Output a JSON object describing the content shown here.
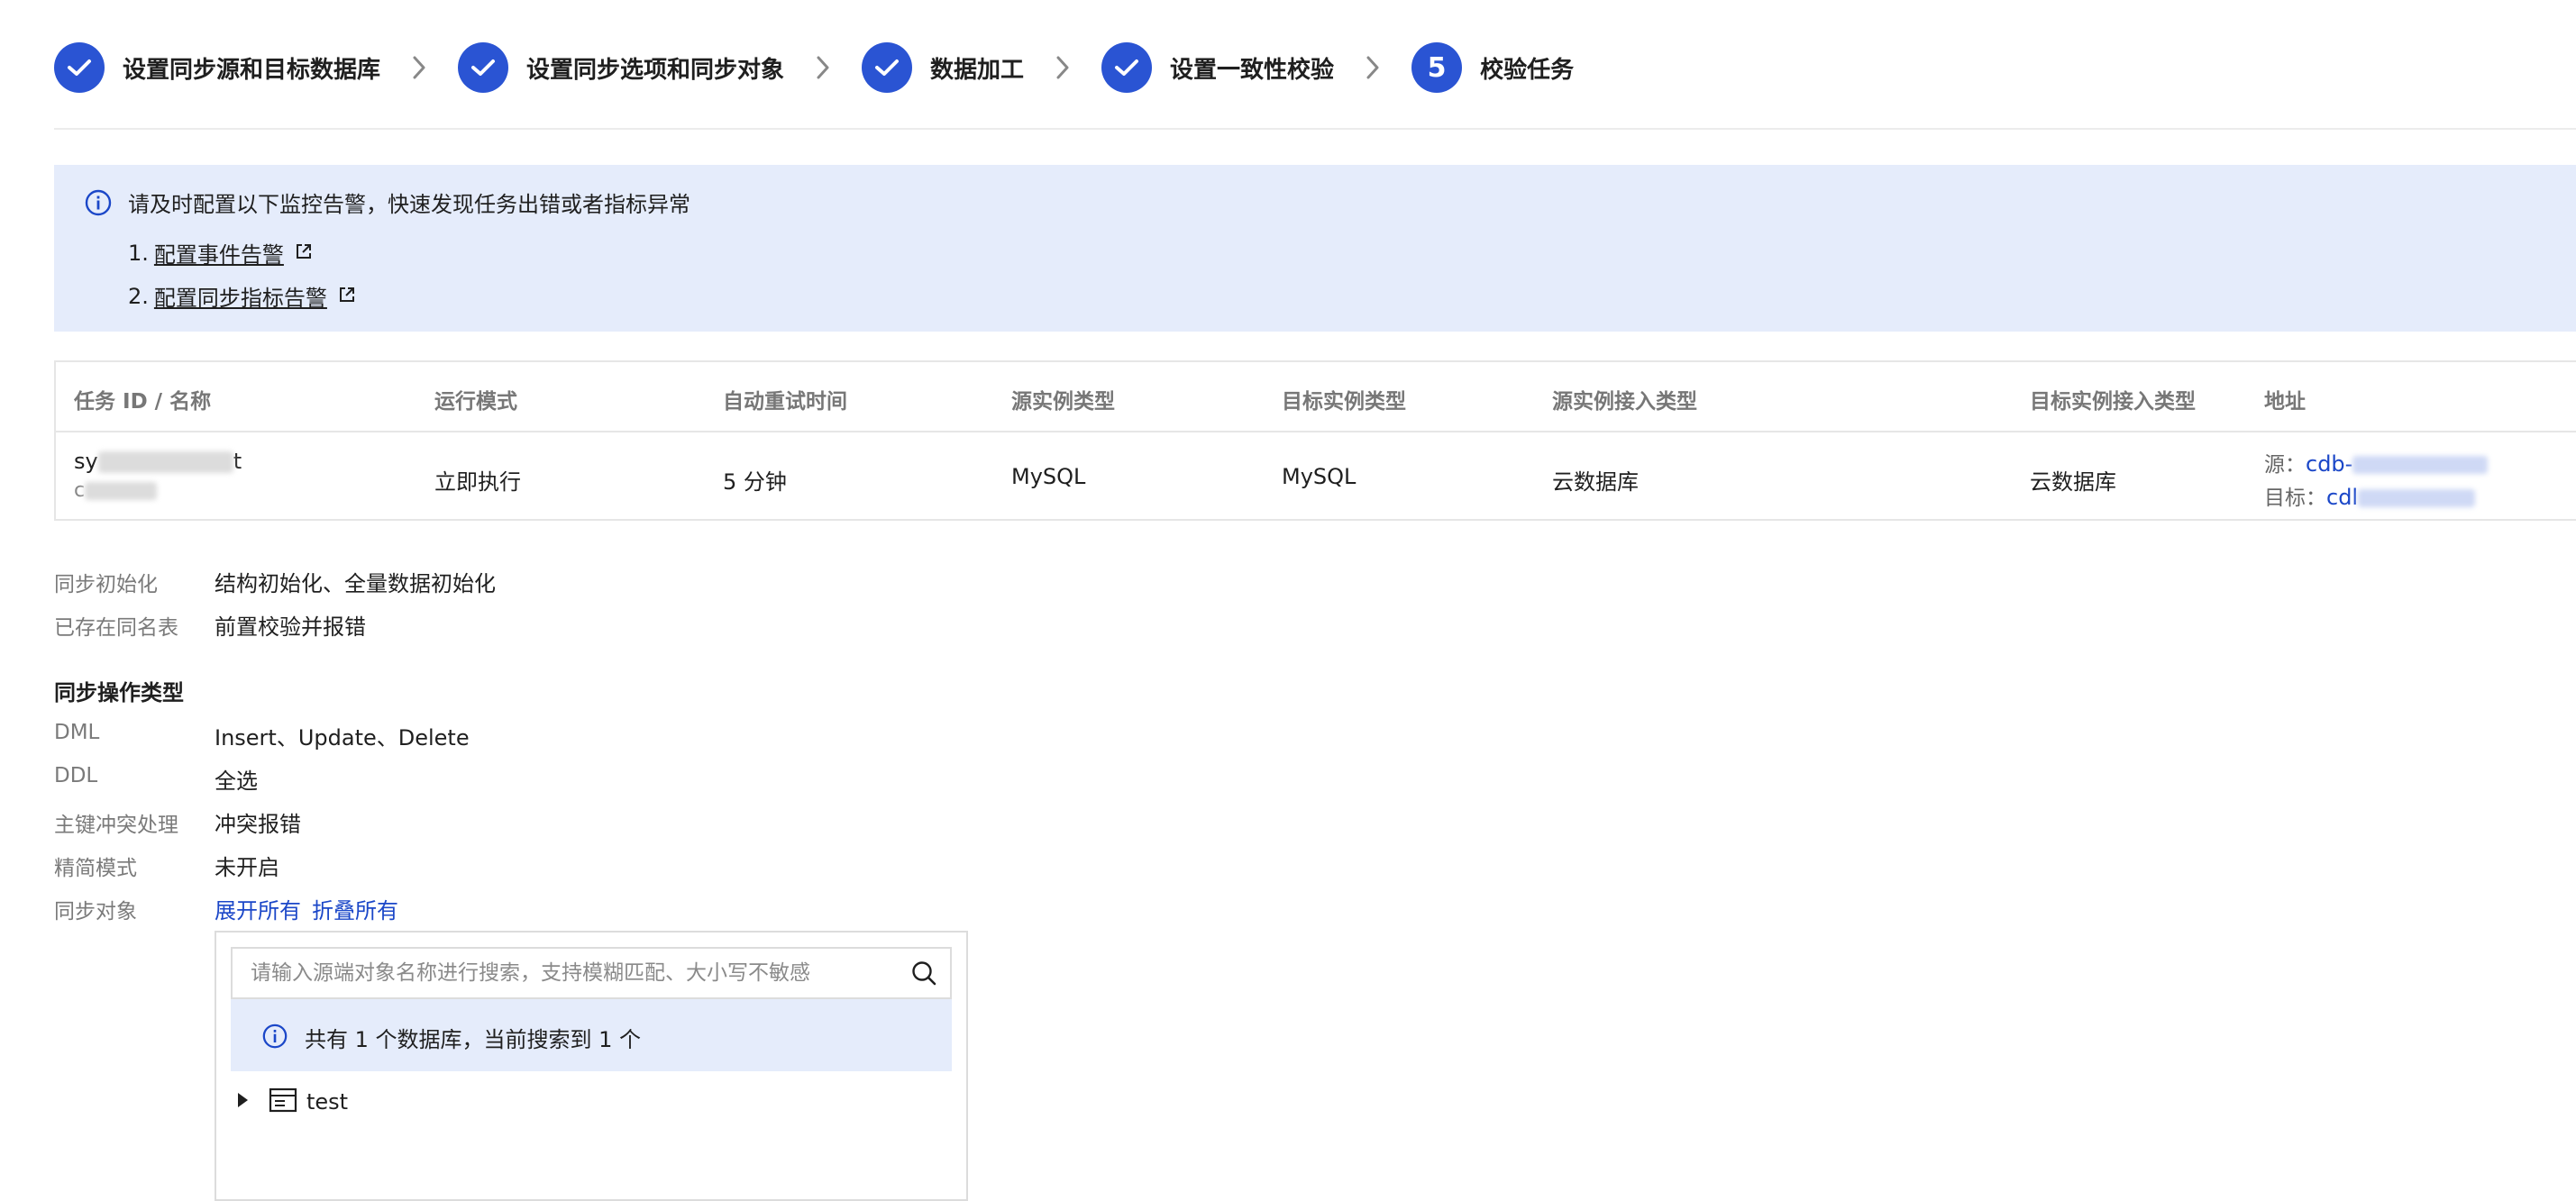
{
  "steps": [
    {
      "label": "设置同步源和目标数据库",
      "status": "done"
    },
    {
      "label": "设置同步选项和同步对象",
      "status": "done"
    },
    {
      "label": "数据加工",
      "status": "done"
    },
    {
      "label": "设置一致性校验",
      "status": "done"
    },
    {
      "label": "校验任务",
      "status": "current",
      "number": "5"
    }
  ],
  "alert": {
    "heading": "请及时配置以下监控告警，快速发现任务出错或者指标异常",
    "items": [
      {
        "prefix": "1.",
        "label": "配置事件告警"
      },
      {
        "prefix": "2.",
        "label": "配置同步指标告警"
      }
    ]
  },
  "table": {
    "headers": {
      "task": "任务 ID / 名称",
      "mode": "运行模式",
      "retry": "自动重试时间",
      "src_type": "源实例类型",
      "dst_type": "目标实例类型",
      "src_access": "源实例接入类型",
      "dst_access": "目标实例接入类型",
      "address": "地址"
    },
    "row": {
      "task_id_prefix": "sy",
      "task_id_suffix": "t",
      "task_name_prefix": "c",
      "mode": "立即执行",
      "retry": "5 分钟",
      "src_type": "MySQL",
      "dst_type": "MySQL",
      "src_access": "云数据库",
      "dst_access": "云数据库",
      "src_addr_label": "源：",
      "src_addr": "cdb-",
      "dst_addr_label": "目标：",
      "dst_addr": "cdl"
    }
  },
  "details": {
    "init_label": "同步初始化",
    "init_value": "结构初始化、全量数据初始化",
    "exist_label": "已存在同名表",
    "exist_value": "前置校验并报错",
    "op_section_title": "同步操作类型",
    "dml_label": "DML",
    "dml_value": "Insert、Update、Delete",
    "ddl_label": "DDL",
    "ddl_value": "全选",
    "conflict_label": "主键冲突处理",
    "conflict_value": "冲突报错",
    "lite_label": "精简模式",
    "lite_value": "未开启",
    "objects_label": "同步对象",
    "expand_all": "展开所有",
    "collapse_all": "折叠所有"
  },
  "objects": {
    "search_placeholder": "请输入源端对象名称进行搜索，支持模糊匹配、大小写不敏感",
    "search_value": "",
    "info": "共有 1 个数据库，当前搜索到 1 个",
    "tree": [
      {
        "label": "test",
        "expanded": false
      }
    ]
  },
  "icons": {
    "step_done": "check-icon",
    "step_separator": "chevron-right-icon",
    "info": "info-circle-icon",
    "external_link": "external-link-icon",
    "search": "search-icon",
    "tree_caret": "caret-right-icon",
    "database": "database-icon"
  },
  "colors": {
    "primary": "#2a54d3",
    "link": "#1b47c8",
    "info_bg": "#e5ecfb",
    "border": "#e6e6e6",
    "muted_text": "#7a7a7a"
  }
}
